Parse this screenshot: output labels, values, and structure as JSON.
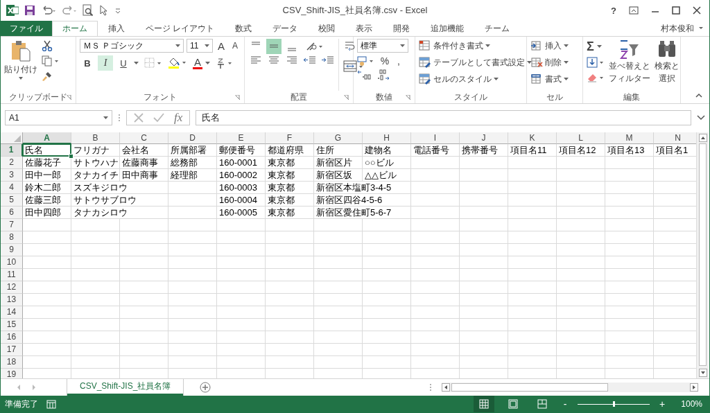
{
  "window": {
    "title": "CSV_Shift-JIS_社員名簿.csv - Excel",
    "help": "?"
  },
  "tabs": [
    {
      "label": "ファイル",
      "kind": "file",
      "selected": false
    },
    {
      "label": "ホーム",
      "kind": "tab",
      "selected": true
    },
    {
      "label": "挿入",
      "kind": "tab",
      "selected": false
    },
    {
      "label": "ページ レイアウト",
      "kind": "tab",
      "selected": false
    },
    {
      "label": "数式",
      "kind": "tab",
      "selected": false
    },
    {
      "label": "データ",
      "kind": "tab",
      "selected": false
    },
    {
      "label": "校閲",
      "kind": "tab",
      "selected": false
    },
    {
      "label": "表示",
      "kind": "tab",
      "selected": false
    },
    {
      "label": "開発",
      "kind": "tab",
      "selected": false
    },
    {
      "label": "追加機能",
      "kind": "tab",
      "selected": false
    },
    {
      "label": "チーム",
      "kind": "tab",
      "selected": false
    }
  ],
  "user": "村本俊和",
  "ribbon": {
    "clipboard": {
      "label": "クリップボード",
      "paste": "貼り付け"
    },
    "font": {
      "label": "フォント",
      "name": "ＭＳ Ｐゴシック",
      "size": "11",
      "grow": "A",
      "shrink": "A",
      "color_glyph": "A",
      "toggles": [
        {
          "glyph": "B",
          "kind": "bold",
          "on": false
        },
        {
          "glyph": "I",
          "kind": "italic",
          "on": true
        },
        {
          "glyph": "U",
          "kind": "underline",
          "on": false
        }
      ]
    },
    "alignment": {
      "label": "配置",
      "vertical": [
        {
          "kind": "top",
          "on": false
        },
        {
          "kind": "middle",
          "on": true
        },
        {
          "kind": "bottom",
          "on": false
        }
      ]
    },
    "number": {
      "label": "数値",
      "format": "標準",
      "percent": "%",
      "comma": ","
    },
    "styles": {
      "label": "スタイル",
      "items": [
        "条件付き書式",
        "テーブルとして書式設定",
        "セルのスタイル"
      ]
    },
    "cells": {
      "label": "セル",
      "items": [
        "挿入",
        "削除",
        "書式"
      ]
    },
    "editing": {
      "label": "編集",
      "sum": "Σ",
      "sort": [
        "並べ替えと",
        "フィルター"
      ],
      "find": [
        "検索と",
        "選択"
      ]
    }
  },
  "formula_bar": {
    "name_box": "A1",
    "fx": "fx",
    "formula": "氏名"
  },
  "sheet": {
    "columns": [
      {
        "label": "A",
        "selected": true
      },
      {
        "label": "B",
        "selected": false
      },
      {
        "label": "C",
        "selected": false
      },
      {
        "label": "D",
        "selected": false
      },
      {
        "label": "E",
        "selected": false
      },
      {
        "label": "F",
        "selected": false
      },
      {
        "label": "G",
        "selected": false
      },
      {
        "label": "H",
        "selected": false
      },
      {
        "label": "I",
        "selected": false
      },
      {
        "label": "J",
        "selected": false
      },
      {
        "label": "K",
        "selected": false
      },
      {
        "label": "L",
        "selected": false
      },
      {
        "label": "M",
        "selected": false
      },
      {
        "label": "N",
        "selected": false
      }
    ],
    "rows": [
      {
        "header": "1",
        "selected": true,
        "cells": [
          "氏名",
          "フリガナ",
          "会社名",
          "所属部署",
          "郵便番号",
          "都道府県",
          "住所",
          "建物名",
          "電話番号",
          "携帯番号",
          "項目名11",
          "項目名12",
          "項目名13",
          "項目名1"
        ]
      },
      {
        "header": "2",
        "selected": false,
        "cells": [
          "佐藤花子",
          "サトウハナ",
          "佐藤商事",
          "総務部",
          "160-0001",
          "東京都",
          "新宿区片",
          "○○ビル",
          null,
          null,
          null,
          null,
          null,
          null
        ]
      },
      {
        "header": "3",
        "selected": false,
        "cells": [
          "田中一郎",
          "タナカイチ",
          "田中商事",
          "経理部",
          "160-0002",
          "東京都",
          "新宿区坂",
          "△△ビル",
          null,
          null,
          null,
          null,
          null,
          null
        ]
      },
      {
        "header": "4",
        "selected": false,
        "cells": [
          "鈴木二郎",
          "スズキジロウ",
          null,
          null,
          "160-0003",
          "東京都",
          "新宿区本塩町3-4-5",
          null,
          null,
          null,
          null,
          null,
          null,
          null
        ]
      },
      {
        "header": "5",
        "selected": false,
        "cells": [
          "佐藤三郎",
          "サトウサブロウ",
          null,
          null,
          "160-0004",
          "東京都",
          "新宿区四谷4-5-6",
          null,
          null,
          null,
          null,
          null,
          null,
          null
        ]
      },
      {
        "header": "6",
        "selected": false,
        "cells": [
          "田中四郎",
          "タナカシロウ",
          null,
          null,
          "160-0005",
          "東京都",
          "新宿区愛住町5-6-7",
          null,
          null,
          null,
          null,
          null,
          null,
          null
        ]
      },
      {
        "header": "7",
        "selected": false
      },
      {
        "header": "8",
        "selected": false
      },
      {
        "header": "9",
        "selected": false
      },
      {
        "header": "10",
        "selected": false
      },
      {
        "header": "11",
        "selected": false
      },
      {
        "header": "12",
        "selected": false
      },
      {
        "header": "13",
        "selected": false
      },
      {
        "header": "14",
        "selected": false
      },
      {
        "header": "15",
        "selected": false
      },
      {
        "header": "16",
        "selected": false
      },
      {
        "header": "17",
        "selected": false
      },
      {
        "header": "18",
        "selected": false
      },
      {
        "header": "19",
        "selected": false
      }
    ]
  },
  "sheet_tabs": [
    {
      "label": "CSV_Shift-JIS_社員名簿",
      "selected": true
    }
  ],
  "status_bar": {
    "status": "準備完了",
    "views": [
      {
        "kind": "normal",
        "selected": true
      },
      {
        "kind": "layout",
        "selected": false
      },
      {
        "kind": "break",
        "selected": false
      }
    ],
    "zoom": {
      "minus": "-",
      "plus": "+",
      "level": 0.5,
      "reading": "100%"
    }
  }
}
